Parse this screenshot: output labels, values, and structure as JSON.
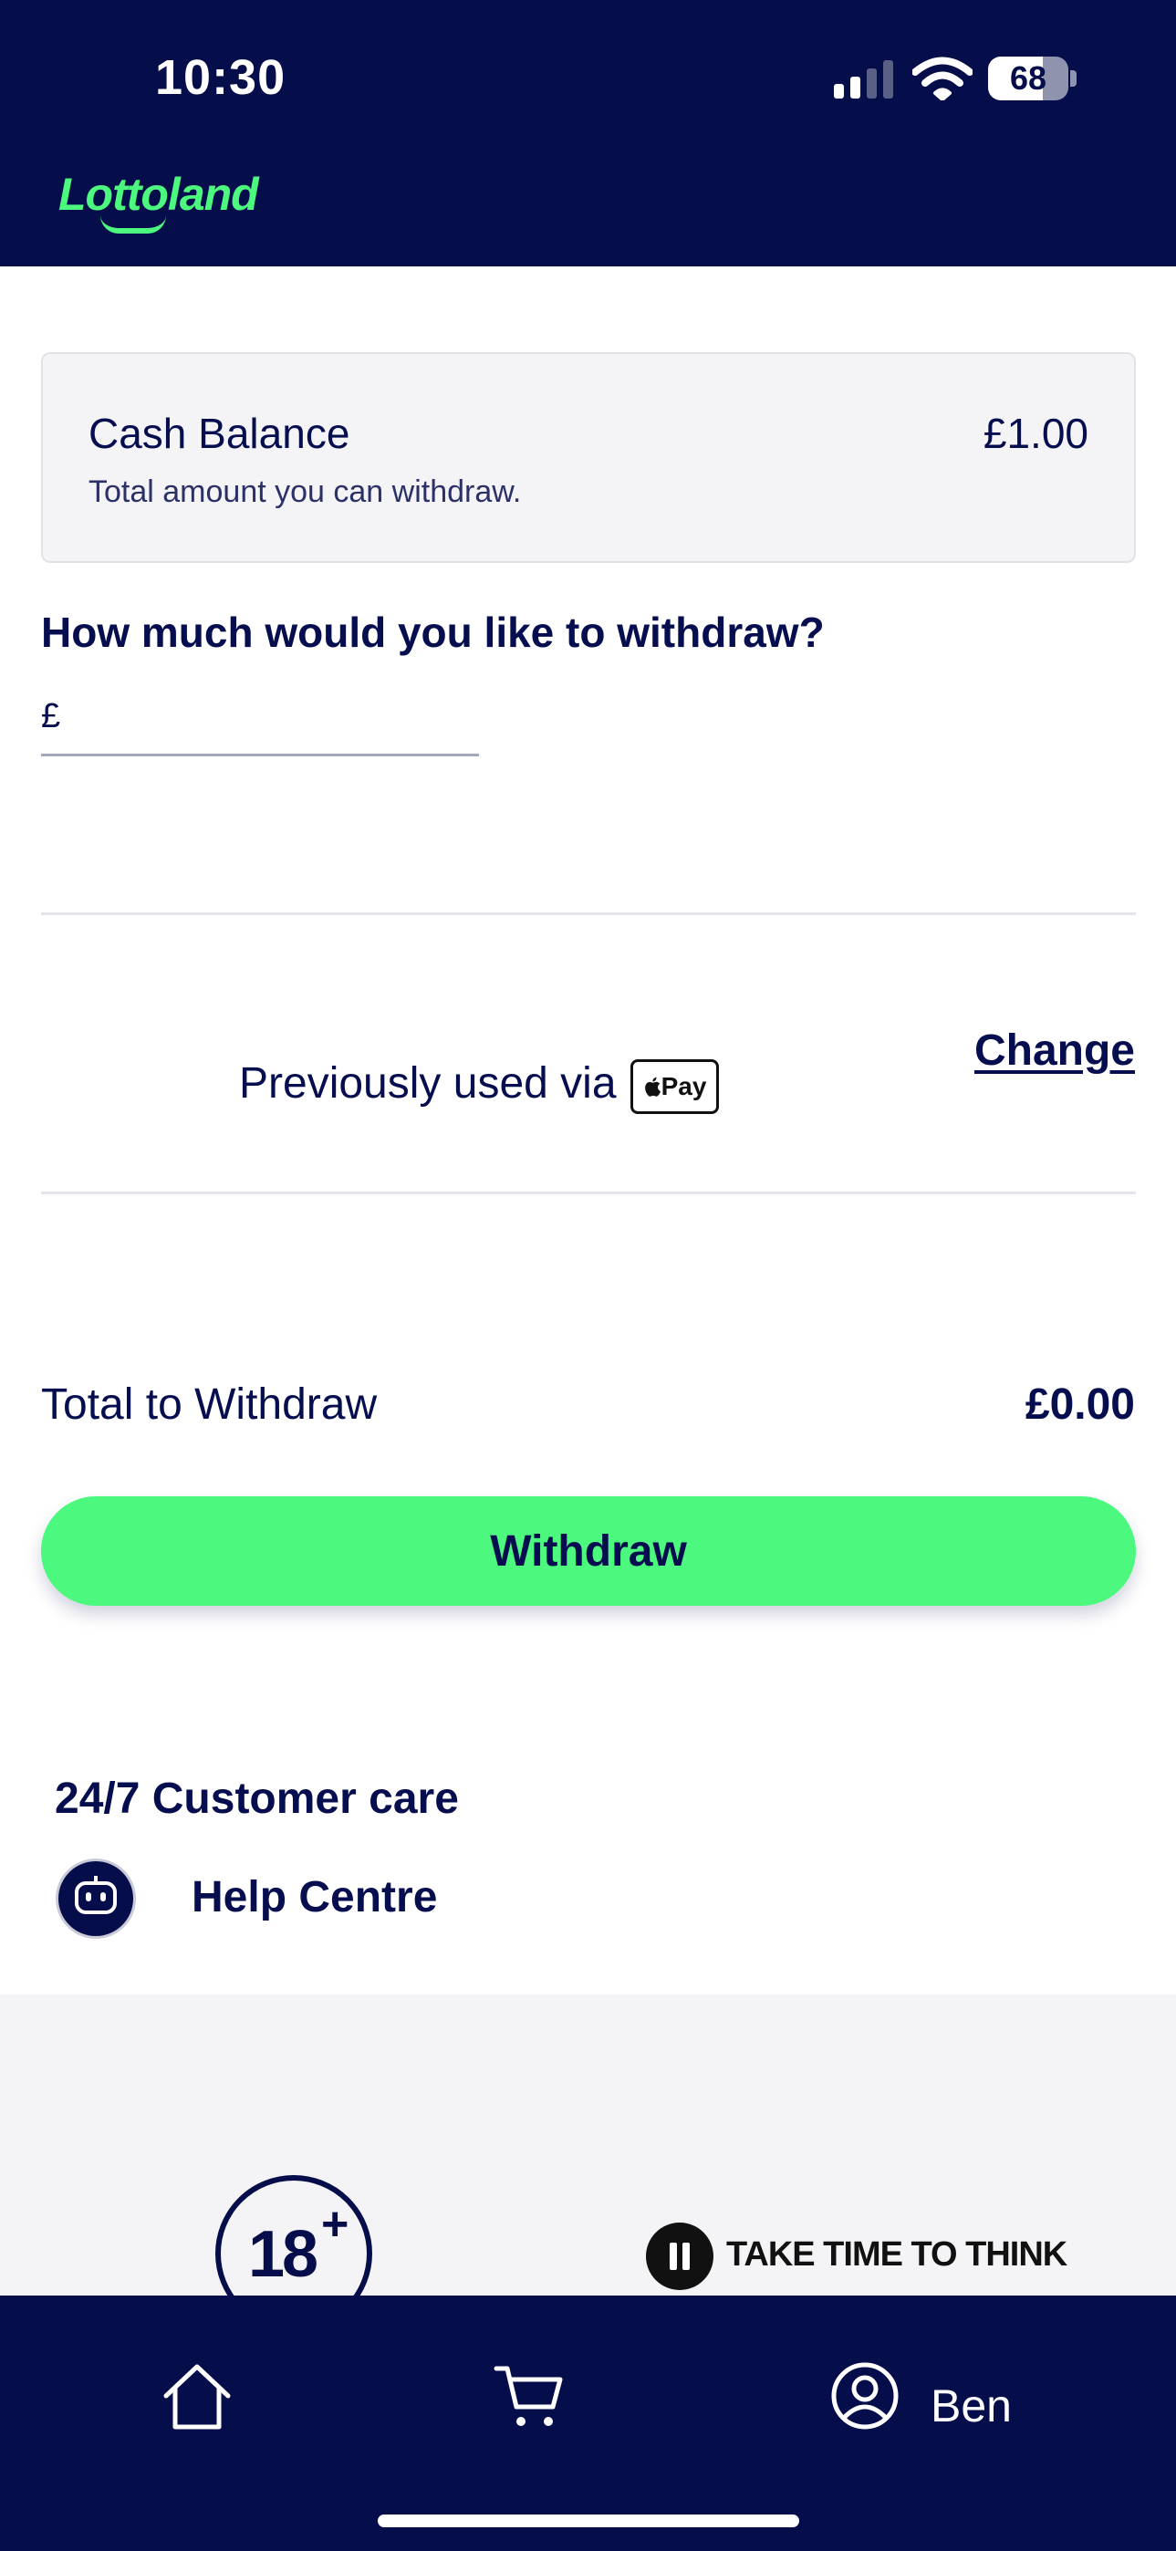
{
  "status_bar": {
    "time": "10:30",
    "battery": "68",
    "battery_level": 0.68,
    "signal_bars": 2,
    "icons": [
      "cellular-signal-icon",
      "wifi-icon",
      "battery-icon"
    ]
  },
  "header": {
    "logo_text": "Lottoland",
    "logo_color": "#4cf97e",
    "background": "#050d4a"
  },
  "balance": {
    "title": "Cash Balance",
    "subtitle": "Total amount you can withdraw.",
    "amount": "£1.00"
  },
  "withdraw_form": {
    "question": "How much would you like to withdraw?",
    "currency_symbol": "£",
    "amount_value": ""
  },
  "payment_method": {
    "text": "Previously used via",
    "badge": "Pay",
    "badge_icon": "apple-logo-icon",
    "change_label": "Change"
  },
  "total": {
    "label": "Total to Withdraw",
    "amount": "£0.00"
  },
  "withdraw_button": {
    "label": "Withdraw",
    "color": "#4cf97e"
  },
  "support": {
    "title": "24/7 Customer care",
    "help_label": "Help Centre",
    "help_icon": "robot-icon"
  },
  "footer": {
    "age_badge": "18",
    "age_badge_plus": "+",
    "take_time_text": "TAKE TIME TO THINK",
    "take_time_icon": "pause-icon"
  },
  "tabbar": {
    "items": [
      {
        "icon": "home-icon"
      },
      {
        "icon": "cart-icon"
      },
      {
        "icon": "user-icon",
        "label": "Ben"
      }
    ]
  }
}
